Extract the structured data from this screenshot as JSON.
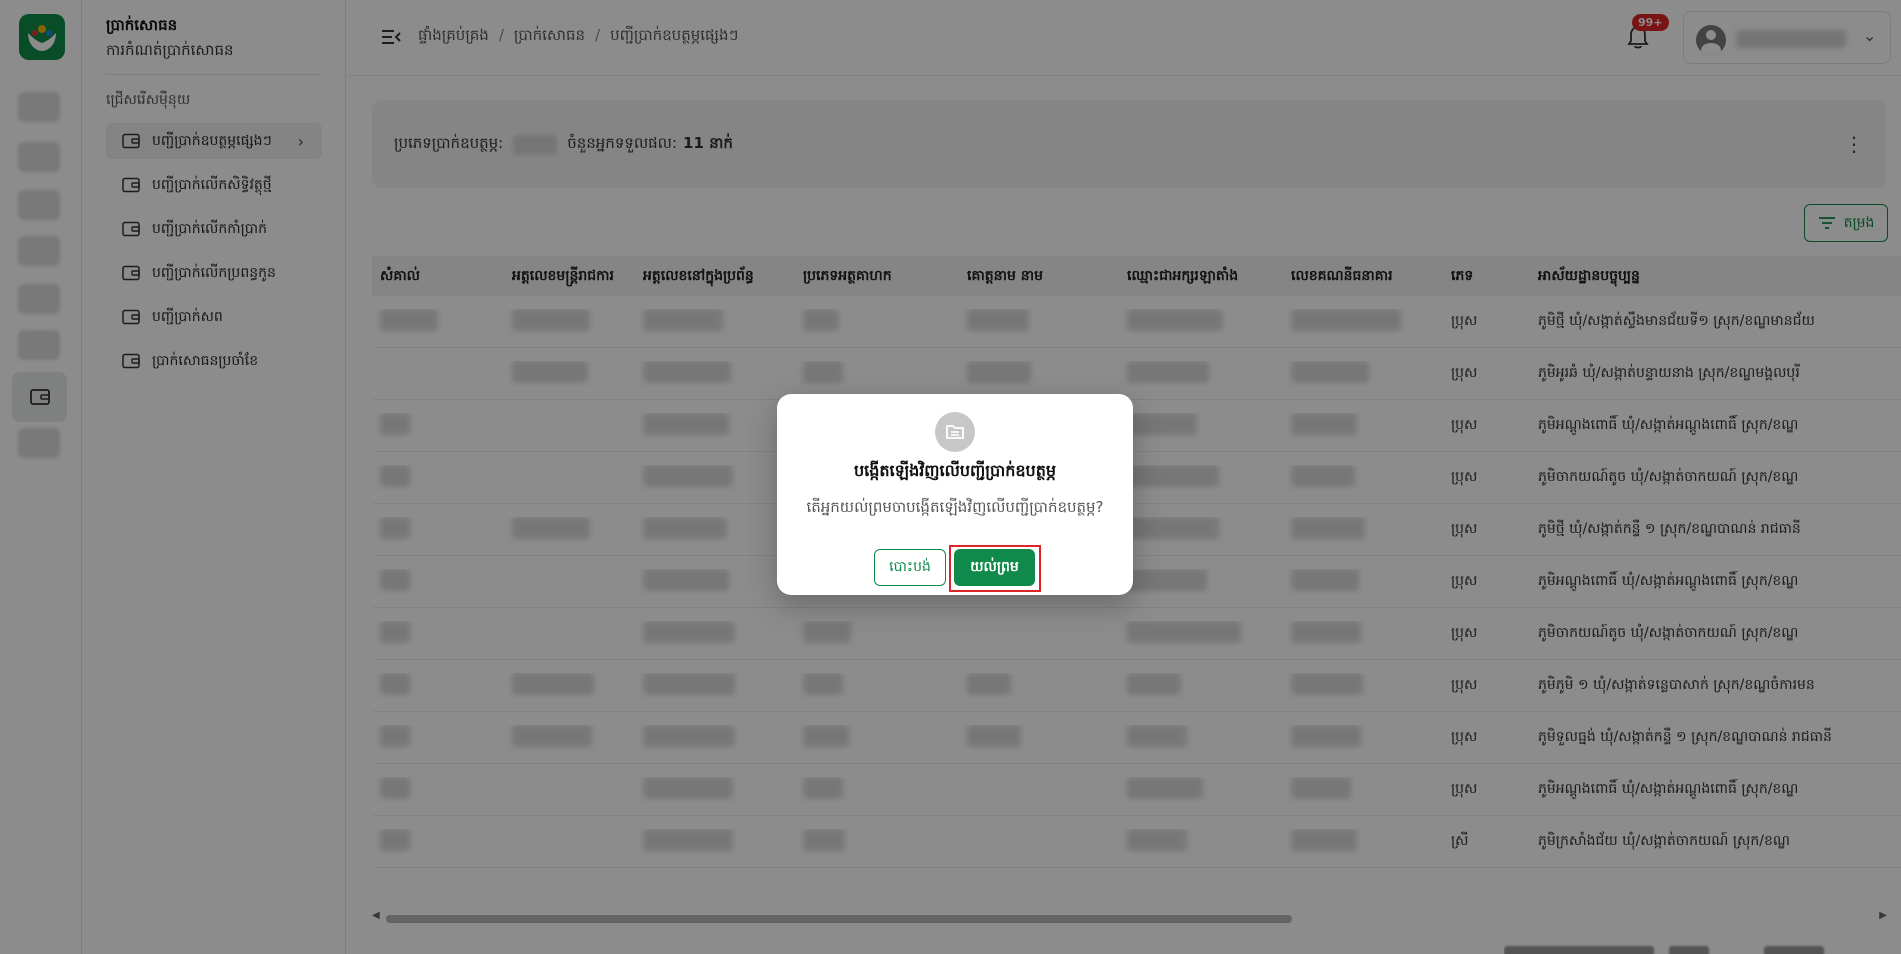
{
  "colors": {
    "brand": "#0f8a4a",
    "danger": "#dc2626",
    "overlay": "rgba(0,0,0,0.45)"
  },
  "sidebar_nav": {
    "title": "ប្រាក់សោធន",
    "subtitle": "ការកំណត់ប្រាក់សោធន",
    "section_label": "ជ្រើសរើសម៉ឺនុយ",
    "items": [
      {
        "label": "បញ្ជីប្រាក់ឧបត្ថម្ភផ្សេងៗ",
        "icon": "wallet-icon",
        "active": true
      },
      {
        "label": "បញ្ជីប្រាក់លើកសិទ្ធិវត្ថុថ្មី",
        "icon": "wallet-icon",
        "active": false
      },
      {
        "label": "បញ្ជីប្រាក់លើកកាំប្រាក់",
        "icon": "wallet-icon",
        "active": false
      },
      {
        "label": "បញ្ជីប្រាក់លើកប្រពន្ធកូន",
        "icon": "wallet-icon",
        "active": false
      },
      {
        "label": "បញ្ជីប្រាក់សព",
        "icon": "wallet-icon",
        "active": false
      },
      {
        "label": "ប្រាក់សោធនប្រចាំខែ",
        "icon": "wallet-icon",
        "active": false
      }
    ]
  },
  "header": {
    "breadcrumb": [
      "ផ្ទាំងគ្រប់គ្រង",
      "ប្រាក់សោធន",
      "បញ្ជីប្រាក់ឧបត្ថម្ភផ្សេងៗ"
    ],
    "notification_badge": "99+",
    "icons": {
      "menu": "menu-collapse-icon",
      "bell": "bell-icon",
      "user": "user-icon",
      "chevron": "chevron-down-icon"
    }
  },
  "info_card": {
    "type_label": "ប្រភេទប្រាក់ឧបត្ថម្ភ:",
    "recipients_label": "ចំនួនអ្នកទទួលផល:",
    "recipients_value": "11 នាក់"
  },
  "filter_button": {
    "label": "តម្រង",
    "icon": "filter-icon"
  },
  "table": {
    "columns": [
      {
        "label": "សំគាល់",
        "width": 132
      },
      {
        "label": "អត្តលេខមន្ត្រីរាជការ",
        "width": 131
      },
      {
        "label": "អត្តលេខនៅក្នុងប្រព័ន្ធ",
        "width": 160
      },
      {
        "label": "ប្រភេទអត្ថគាហក",
        "width": 164
      },
      {
        "label": "គោត្តនាម នាម",
        "width": 160
      },
      {
        "label": "ឈ្មោះជាអក្សរឡាតាំង",
        "width": 164
      },
      {
        "label": "លេខគណនីធនាគារ",
        "width": 160
      },
      {
        "label": "ភេទ",
        "width": 87
      },
      {
        "label": "អាស័យដ្ឋានបច្ចុប្បន្ន",
        "width": 370
      }
    ],
    "rows": [
      {
        "gender": "ប្រុស",
        "address": "ភូមិថ្មី ឃុំ/សង្កាត់ស្ទឹងមានជ័យទី១ ស្រុក/ខណ្ឌមានជ័យ"
      },
      {
        "gender": "ប្រុស",
        "address": "ភូមិអូរឆំ ឃុំ/សង្កាត់បន្ទាយនាង ស្រុក/ខណ្ឌមង្គលបុរី"
      },
      {
        "gender": "ប្រុស",
        "address": "ភូមិអណ្តូងពោធិ៍ ឃុំ/សង្កាត់អណ្តូងពោធិ៍ ស្រុក/ខណ្ឌ"
      },
      {
        "gender": "ប្រុស",
        "address": "ភូមិចាកយណ៍តូច ឃុំ/សង្កាត់ចាកយណ៍ ស្រុក/ខណ្ឌ"
      },
      {
        "gender": "ប្រុស",
        "address": "ភូមិថ្មី ឃុំ/សង្កាត់កន្ទឺ ១ ស្រុក/ខណ្ឌបាណន់ រាជធានី"
      },
      {
        "gender": "ប្រុស",
        "address": "ភូមិអណ្តូងពោធិ៍ ឃុំ/សង្កាត់អណ្តូងពោធិ៍ ស្រុក/ខណ្ឌ"
      },
      {
        "gender": "ប្រុស",
        "address": "ភូមិចាកយណ៍តូច ឃុំ/សង្កាត់ចាកយណ៍ ស្រុក/ខណ្ឌ"
      },
      {
        "gender": "ប្រុស",
        "address": "ភូមិភូមិ ១ ឃុំ/សង្កាត់ទន្លេបាសាក់ ស្រុក/ខណ្ឌចំការមន"
      },
      {
        "gender": "ប្រុស",
        "address": "ភូមិទួលធ្នង់ ឃុំ/សង្កាត់កន្ទឺ ១ ស្រុក/ខណ្ឌបាណន់ រាជធានី"
      },
      {
        "gender": "ប្រុស",
        "address": "ភូមិអណ្តូងពោធិ៍ ឃុំ/សង្កាត់អណ្តូងពោធិ៍ ស្រុក/ខណ្ឌ"
      },
      {
        "gender": "ស្រី",
        "address": "ភូមិក្រសាំងជ័យ ឃុំ/សង្កាត់ចាកយណ៍ ស្រុក/ខណ្ឌ"
      }
    ]
  },
  "modal": {
    "icon": "folder-icon",
    "title": "បង្កើតឡើងវិញលើបញ្ជីប្រាក់ឧបត្ថម្ភ",
    "message": "តើអ្នកយល់ព្រមចាបង្កើតឡើងវិញលើបញ្ជីប្រាក់ឧបត្ថម្ភ?",
    "cancel_label": "បោះបង់",
    "confirm_label": "យល់ព្រម"
  }
}
